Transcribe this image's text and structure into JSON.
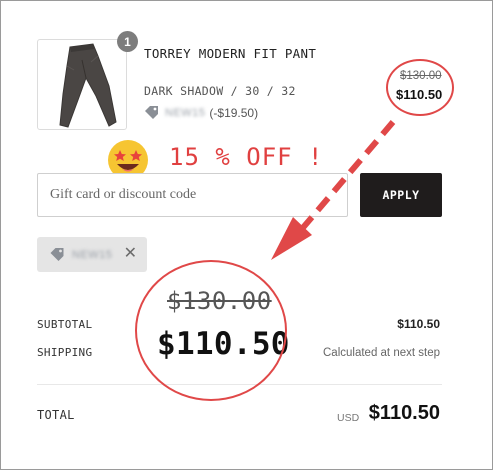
{
  "product": {
    "name": "TORREY MODERN FIT PANT",
    "variant": "DARK SHADOW / 30 / 32",
    "quantity": "1",
    "discount_amount": "(-$19.50)",
    "original_price": "$130.00",
    "discounted_price": "$110.50",
    "image_icon": "pants-image"
  },
  "promo": {
    "emoji": "star-struck-emoji",
    "text": "15 % OFF !"
  },
  "discount_form": {
    "placeholder": "Gift card or discount code",
    "apply_label": "APPLY"
  },
  "applied_code": {
    "icon": "tag-icon",
    "close_icon": "close-icon"
  },
  "callout": {
    "original_price": "$130.00",
    "discounted_price": "$110.50"
  },
  "summary": {
    "subtotal_label": "SUBTOTAL",
    "subtotal_value": "$110.50",
    "shipping_label": "SHIPPING",
    "shipping_value": "Calculated at next step",
    "total_label": "TOTAL",
    "total_currency": "USD",
    "total_value": "$110.50"
  },
  "colors": {
    "annotation_red": "#e04848",
    "apply_button_bg": "#1f1c1c",
    "chip_bg": "#e5e5e5"
  }
}
